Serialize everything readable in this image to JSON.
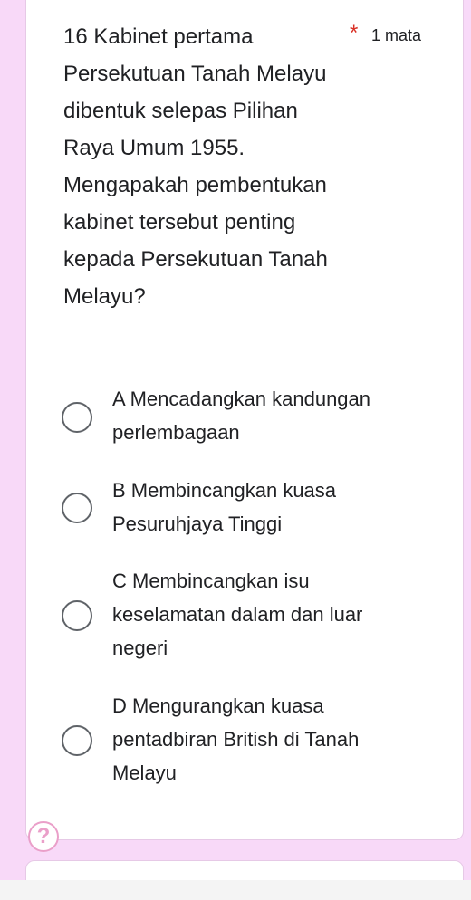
{
  "question": {
    "text": "16 Kabinet pertama Persekutuan Tanah Melayu dibentuk selepas Pilihan Raya Umum 1955. Mengapakah pembentukan kabinet tersebut penting kepada Persekutuan Tanah Melayu?",
    "required_mark": "*",
    "points": "1 mata"
  },
  "options": [
    {
      "label": "A Mencadangkan kandungan perlembagaan",
      "selected": false
    },
    {
      "label": "B Membincangkan kuasa Pesuruhjaya Tinggi",
      "selected": false
    },
    {
      "label": "C Membincangkan isu keselamatan dalam dan luar negeri",
      "selected": false
    },
    {
      "label": "D Mengurangkan kuasa pentadbiran British di Tanah Melayu",
      "selected": false
    }
  ],
  "help": {
    "icon": "question-mark-icon",
    "glyph": "?"
  },
  "colors": {
    "background": "#f8d9f8",
    "required": "#d93025",
    "help": "#ea9fc9"
  }
}
